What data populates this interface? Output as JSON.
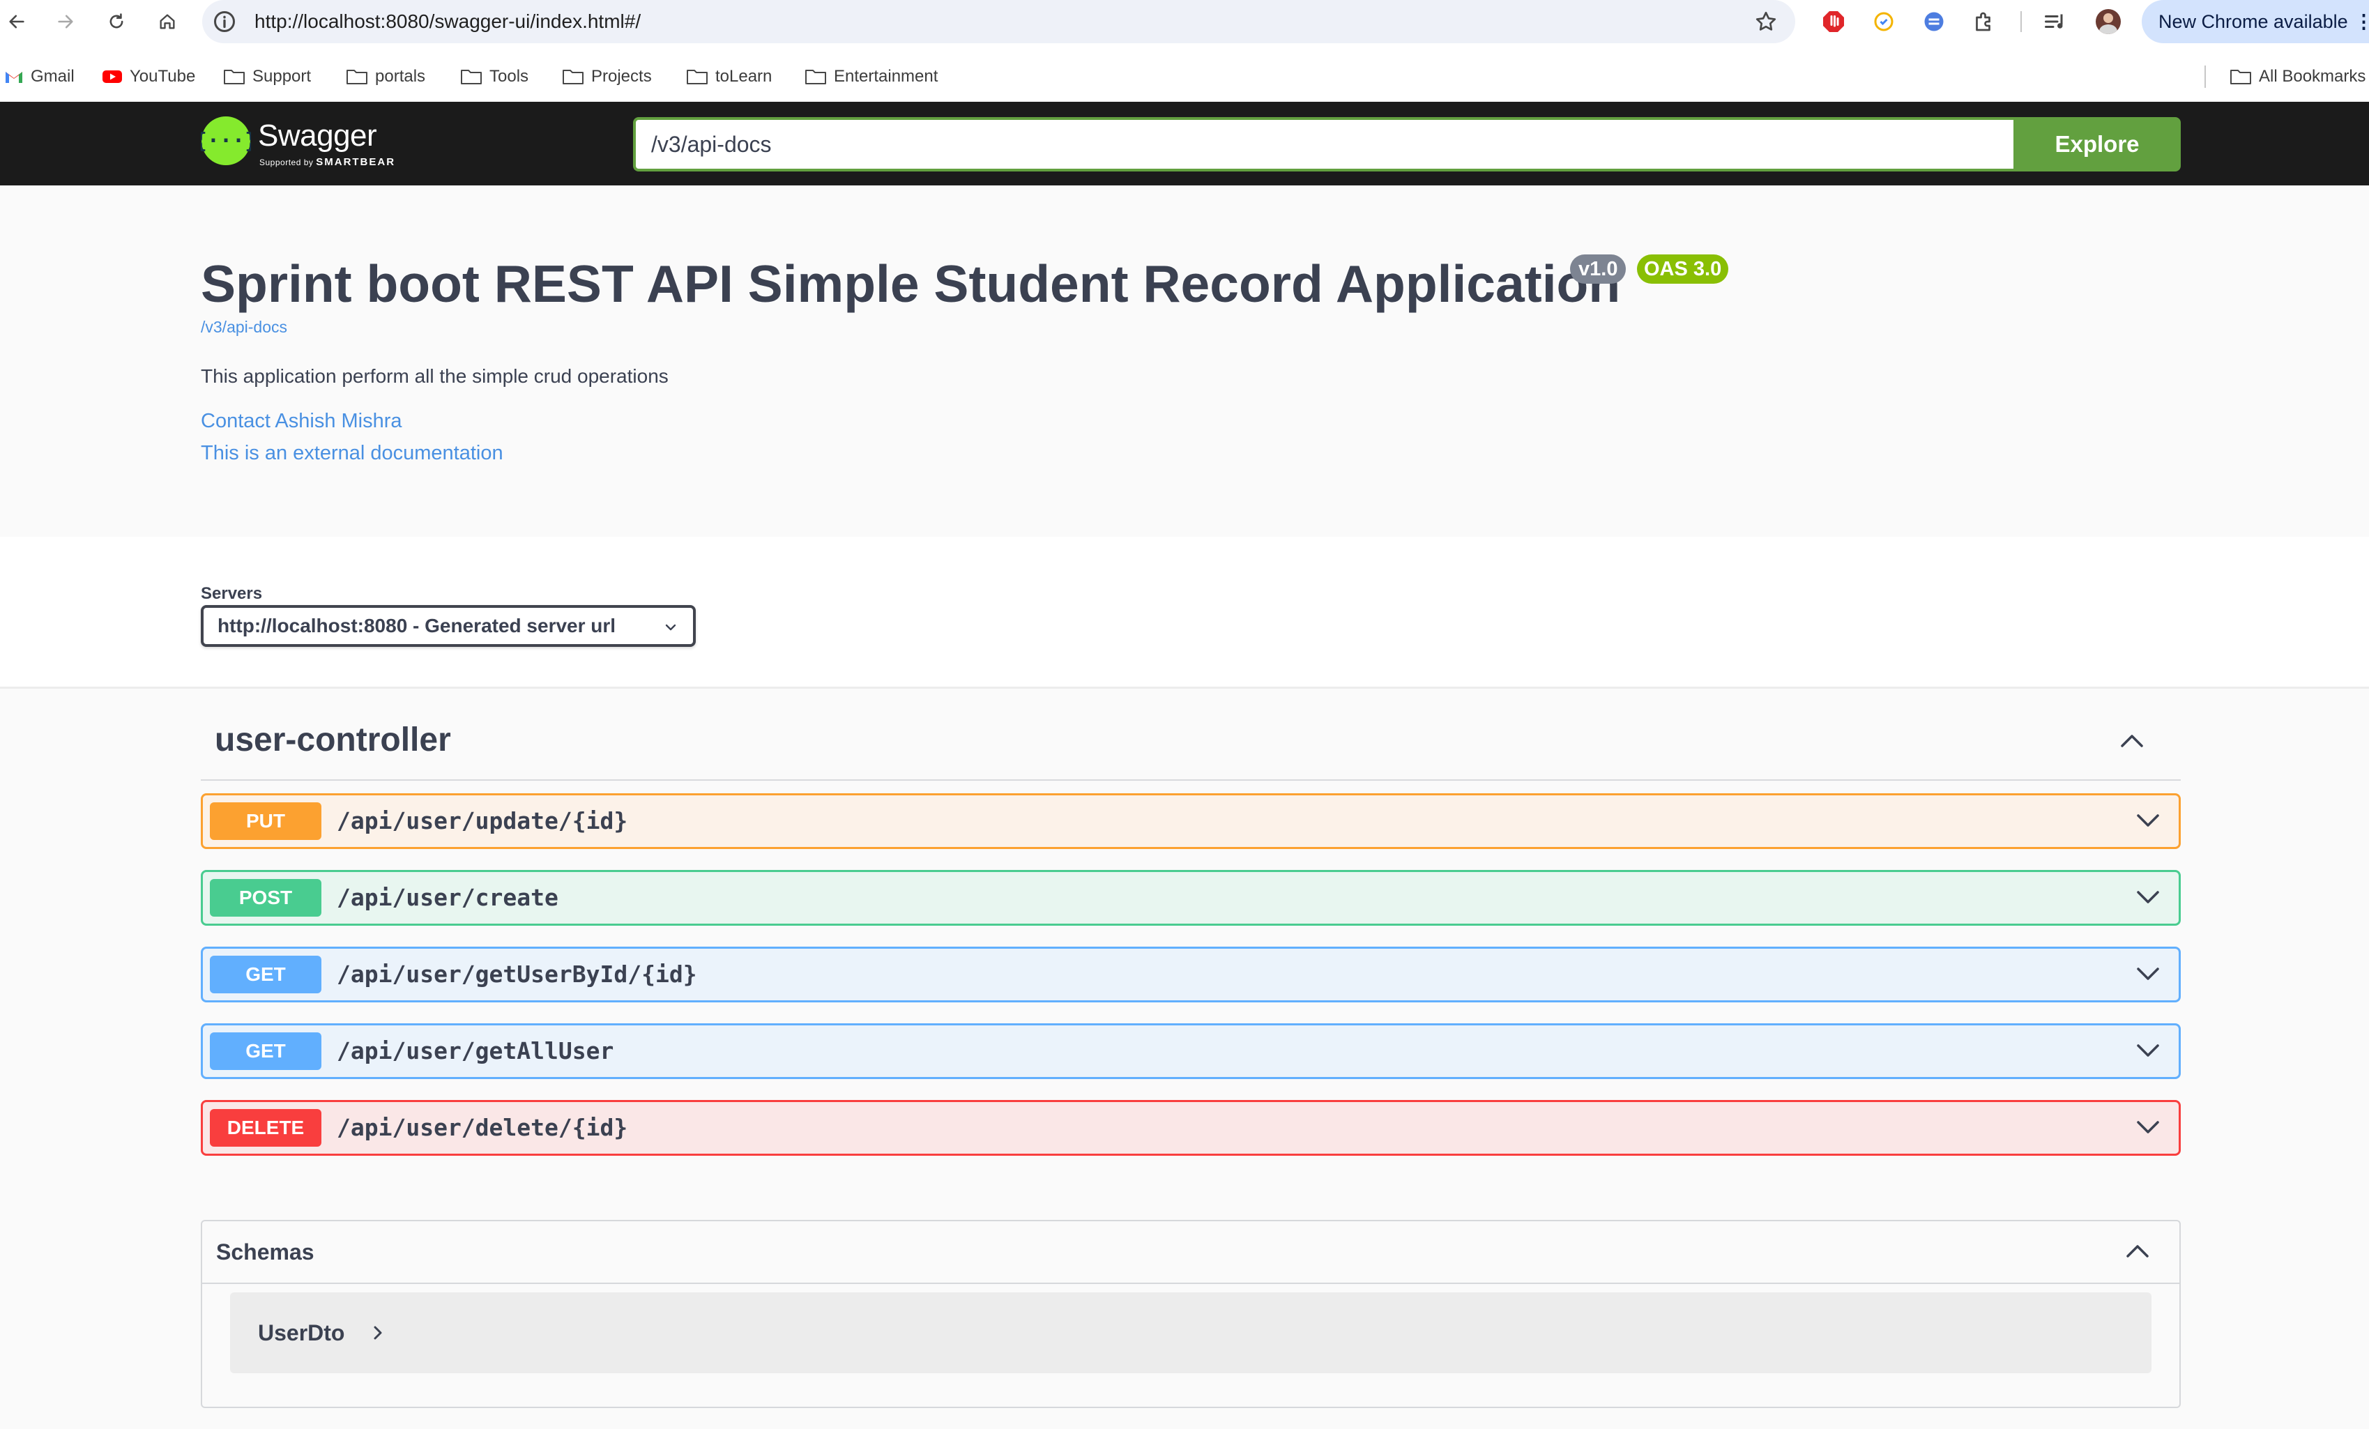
{
  "browser": {
    "url": "http://localhost:8080/swagger-ui/index.html#/",
    "update_label": "New Chrome available",
    "bookmarks": [
      "Gmail",
      "YouTube",
      "Support",
      "portals",
      "Tools",
      "Projects",
      "toLearn",
      "Entertainment"
    ],
    "all_bookmarks": "All Bookmarks"
  },
  "topbar": {
    "logo_text": "Swagger",
    "logo_sub_prefix": "Supported by",
    "logo_sub_brand": "SMARTBEAR",
    "spec_url": "/v3/api-docs",
    "explore_label": "Explore"
  },
  "info": {
    "title": "Sprint boot REST API Simple Student Record Application",
    "version_badge": "v1.0",
    "oas_badge": "OAS 3.0",
    "spec_link": "/v3/api-docs",
    "description": "This application perform all the simple crud operations",
    "contact_link": "Contact Ashish Mishra",
    "external_doc_link": "This is an external documentation"
  },
  "servers": {
    "label": "Servers",
    "selected": "http://localhost:8080 - Generated server url"
  },
  "tag": {
    "name": "user-controller",
    "operations": [
      {
        "method": "PUT",
        "path": "/api/user/update/{id}"
      },
      {
        "method": "POST",
        "path": "/api/user/create"
      },
      {
        "method": "GET",
        "path": "/api/user/getUserById/{id}"
      },
      {
        "method": "GET",
        "path": "/api/user/getAllUser"
      },
      {
        "method": "DELETE",
        "path": "/api/user/delete/{id}"
      }
    ]
  },
  "schemas": {
    "title": "Schemas",
    "models": [
      "UserDto"
    ]
  },
  "colors": {
    "put": "#fca130",
    "post": "#49cc90",
    "get": "#61affe",
    "delete": "#f93e3e",
    "explore": "#62a03f",
    "link": "#4990e2"
  }
}
